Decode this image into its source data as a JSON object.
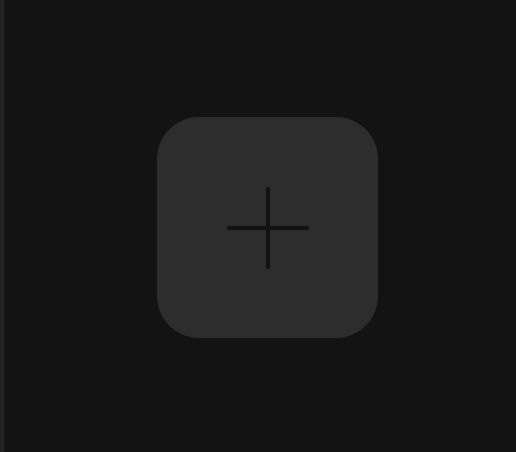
{
  "add_tile": {
    "icon": "plus-icon",
    "label": ""
  },
  "colors": {
    "background": "#131313",
    "tile": "#2d2d2d",
    "icon": "#121212"
  }
}
